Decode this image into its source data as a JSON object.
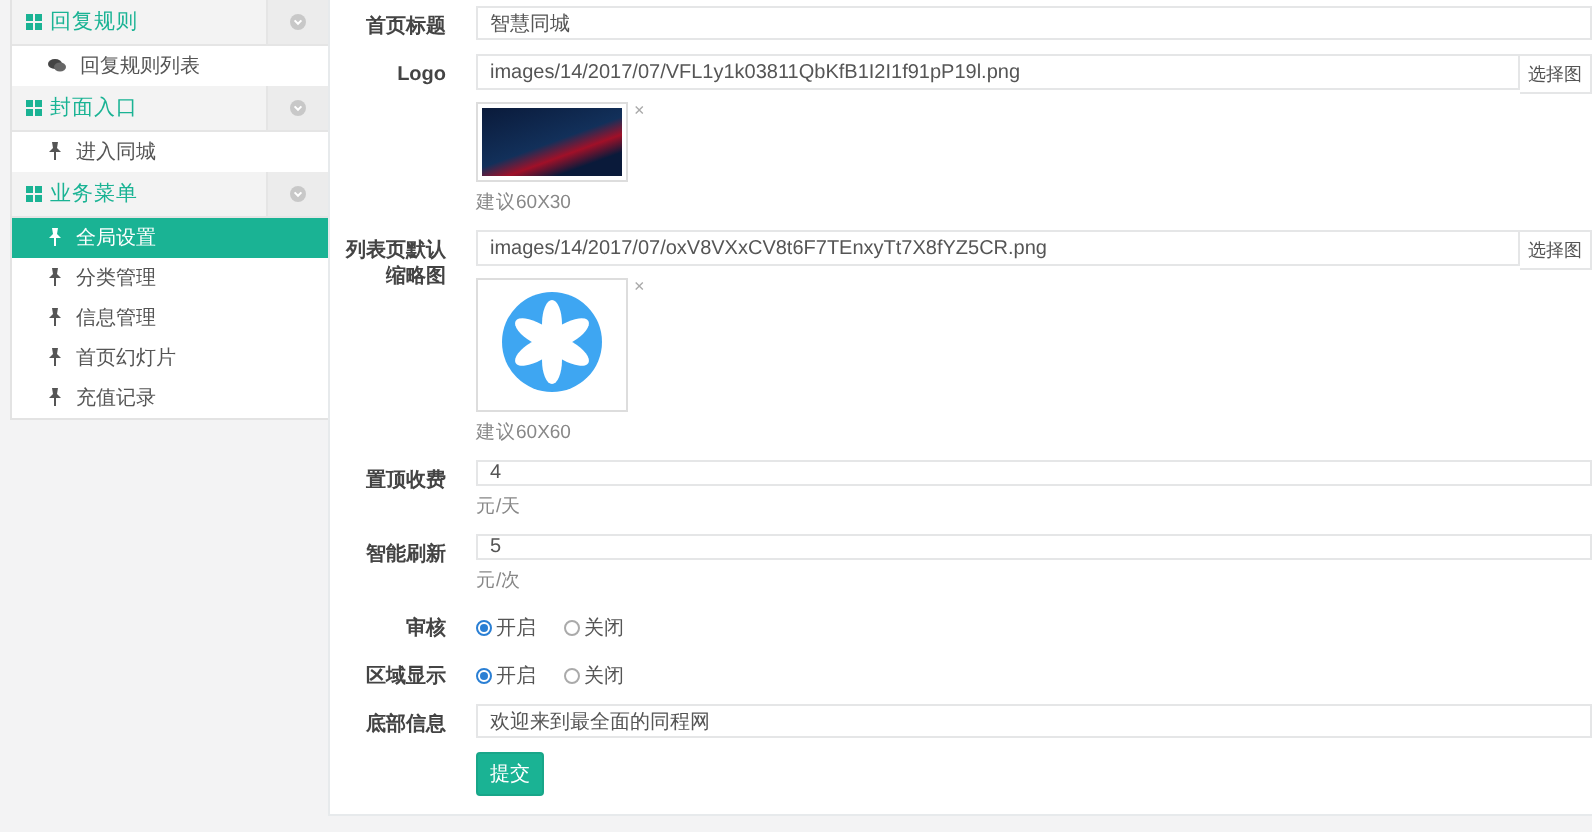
{
  "sidebar": {
    "groups": [
      {
        "title": "回复规则",
        "items": [
          {
            "label": "回复规则列表",
            "kind": "comment",
            "selected": false
          }
        ]
      },
      {
        "title": "封面入口",
        "items": [
          {
            "label": "进入同城",
            "kind": "pin",
            "selected": false
          }
        ]
      },
      {
        "title": "业务菜单",
        "items": [
          {
            "label": "全局设置",
            "kind": "pin",
            "selected": true
          },
          {
            "label": "分类管理",
            "kind": "pin",
            "selected": false
          },
          {
            "label": "信息管理",
            "kind": "pin",
            "selected": false
          },
          {
            "label": "首页幻灯片",
            "kind": "pin",
            "selected": false
          },
          {
            "label": "充值记录",
            "kind": "pin",
            "selected": false
          }
        ]
      }
    ]
  },
  "form": {
    "rows": [
      {
        "kind": "text",
        "label": "首页标题",
        "value": "智慧同城"
      },
      {
        "kind": "image",
        "label": "Logo",
        "value": "images/14/2017/07/VFL1y1k03811QbKfB1I2I1f91pP19l.png",
        "button": "选择图",
        "preview": {
          "kind": "photo"
        },
        "remove": "×",
        "hint": "建议60X30"
      },
      {
        "kind": "image",
        "label": "列表页默认缩略图",
        "value": "images/14/2017/07/oxV8VXxCV8t6F7TEnxyTt7X8fYZ5CR.png",
        "button": "选择图",
        "preview": {
          "kind": "flower"
        },
        "remove": "×",
        "hint": "建议60X60"
      },
      {
        "kind": "text",
        "label": "置顶收费",
        "value": "4",
        "hint": "元/天"
      },
      {
        "kind": "text",
        "label": "智能刷新",
        "value": "5",
        "hint": "元/次"
      },
      {
        "kind": "radio",
        "label": "审核",
        "options": [
          {
            "label": "开启",
            "selected": true
          },
          {
            "label": "关闭",
            "selected": false
          }
        ]
      },
      {
        "kind": "radio",
        "label": "区域显示",
        "options": [
          {
            "label": "开启",
            "selected": true
          },
          {
            "label": "关闭",
            "selected": false
          }
        ]
      },
      {
        "kind": "text",
        "label": "底部信息",
        "value": "欢迎来到最全面的同程网"
      },
      {
        "kind": "submit",
        "label": "提交"
      }
    ]
  }
}
